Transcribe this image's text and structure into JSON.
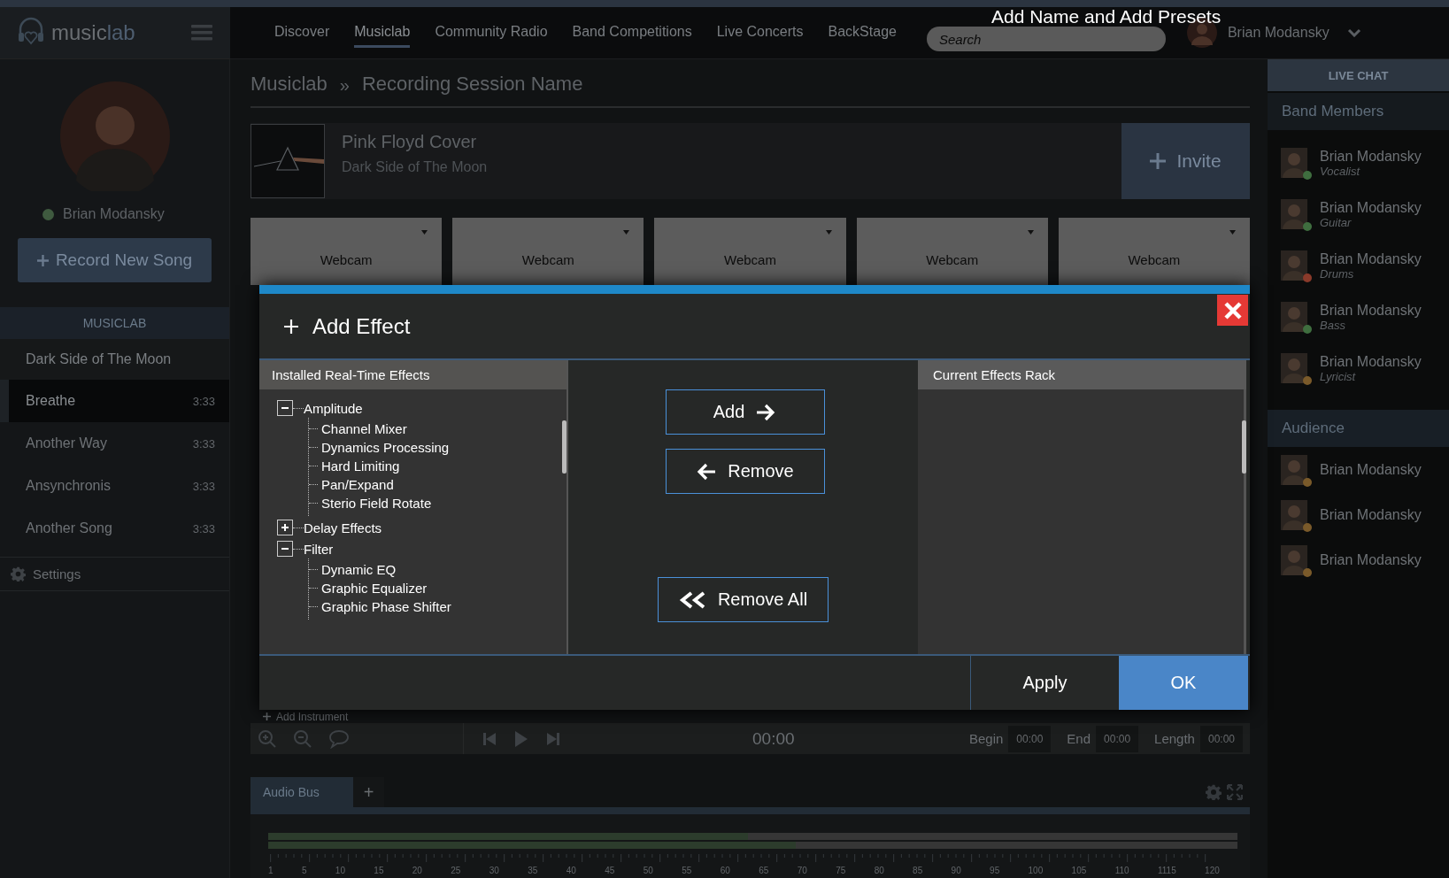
{
  "annotation": "Add Name and Add Presets",
  "logo_parts": [
    "music",
    "lab"
  ],
  "nav": [
    {
      "label": "Discover",
      "selected": false
    },
    {
      "label": "Musiclab",
      "selected": true
    },
    {
      "label": "Community Radio",
      "selected": false
    },
    {
      "label": "Band Competitions",
      "selected": false
    },
    {
      "label": "Live Concerts",
      "selected": false
    },
    {
      "label": "BackStage",
      "selected": false
    }
  ],
  "search": {
    "placeholder": "Search"
  },
  "user": {
    "name": "Brian Modansky"
  },
  "sidebar": {
    "profile_name": "Brian Modansky",
    "online": true,
    "record_button": "Record New Song",
    "section_title": "MUSICLAB",
    "album": "Dark Side of The Moon",
    "songs": [
      {
        "title": "Breathe",
        "duration": "3:33",
        "selected": true
      },
      {
        "title": "Another Way",
        "duration": "3:33",
        "selected": false
      },
      {
        "title": "Ansynchronis",
        "duration": "3:33",
        "selected": false
      },
      {
        "title": "Another Song",
        "duration": "3:33",
        "selected": false
      }
    ],
    "settings": "Settings"
  },
  "breadcrumb": {
    "items": [
      "Musiclab",
      "Recording Session Name"
    ],
    "separator": "»"
  },
  "session": {
    "title": "Pink Floyd Cover",
    "subtitle": "Dark Side of The Moon",
    "invite_button": "Invite"
  },
  "webcams": [
    {
      "label": "Webcam"
    },
    {
      "label": "Webcam"
    },
    {
      "label": "Webcam"
    },
    {
      "label": "Webcam"
    },
    {
      "label": "Webcam"
    }
  ],
  "dialog": {
    "title": "Add Effect",
    "installed_header": "Installed Real-Time Effects",
    "tree": [
      {
        "label": "Amplitude",
        "expanded": true,
        "children": [
          {
            "label": "Channel Mixer"
          },
          {
            "label": "Dynamics Processing"
          },
          {
            "label": "Hard Limiting"
          },
          {
            "label": "Pan/Expand"
          },
          {
            "label": "Sterio Field Rotate"
          }
        ]
      },
      {
        "label": "Delay Effects",
        "expanded": false
      },
      {
        "label": "Filter",
        "expanded": true,
        "children": [
          {
            "label": "Dynamic EQ"
          },
          {
            "label": "Graphic Equalizer"
          },
          {
            "label": "Graphic Phase Shifter"
          }
        ]
      }
    ],
    "add_button": "Add",
    "remove_button": "Remove",
    "remove_all_button": "Remove All",
    "rack_header": "Current Effects Rack",
    "apply_button": "Apply",
    "ok_button": "OK"
  },
  "add_instrument": "Add Instrument",
  "transport": {
    "time": "00:00",
    "begin_label": "Begin",
    "begin": "00:00",
    "end_label": "End",
    "end": "00:00",
    "length_label": "Length",
    "length": "00:00"
  },
  "audio_bus": {
    "tab": "Audio Bus",
    "add_tab": "+",
    "meters": [
      {
        "level": 0.495
      },
      {
        "level": 0.544
      }
    ],
    "ruler": [
      "1",
      "5",
      "10",
      "15",
      "20",
      "25",
      "30",
      "35",
      "40",
      "45",
      "50",
      "55",
      "60",
      "65",
      "70",
      "75",
      "80",
      "85",
      "90",
      "95",
      "100",
      "105",
      "110",
      "1115",
      "120"
    ]
  },
  "live_chat": "LIVE CHAT",
  "band_members": {
    "title": "Band Members",
    "members": [
      {
        "name": "Brian Modansky",
        "role": "Vocalist",
        "color": "#3f6e3f"
      },
      {
        "name": "Brian Modansky",
        "role": "Guitar",
        "color": "#3f6e3f"
      },
      {
        "name": "Brian Modansky",
        "role": "Drums",
        "color": "#8a3a2a"
      },
      {
        "name": "Brian Modansky",
        "role": "Bass",
        "color": "#3f6e3f"
      },
      {
        "name": "Brian Modansky",
        "role": "Lyricist",
        "color": "#7a5a2a"
      }
    ]
  },
  "audience": {
    "title": "Audience",
    "members": [
      {
        "name": "Brian Modansky",
        "color": "#7a5a2a"
      },
      {
        "name": "Brian Modansky",
        "color": "#7a5a2a"
      },
      {
        "name": "Brian Modansky",
        "color": "#7a5a2a"
      }
    ]
  }
}
